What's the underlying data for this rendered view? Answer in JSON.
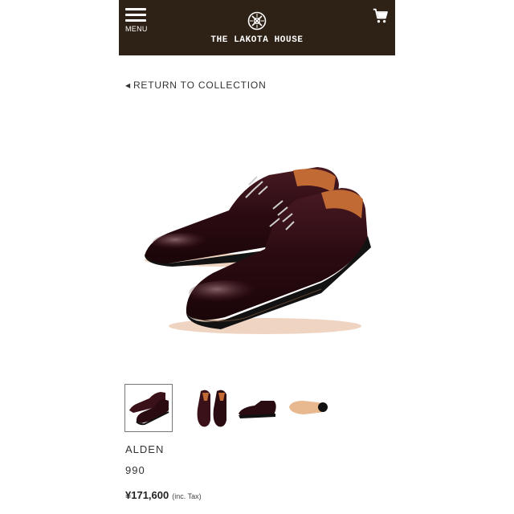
{
  "header": {
    "menu_label": "MENU",
    "brand": "THE LAKOTA HOUSE",
    "logo_icon": "lakota-emblem-icon",
    "cart_icon": "cart-icon",
    "background": "#2e2115"
  },
  "nav": {
    "back_label": "RETURN TO COLLECTION"
  },
  "product": {
    "main_image": "oxford-shoe-pair-image",
    "thumbnails": [
      {
        "name": "pair-angled-view",
        "selected": true
      },
      {
        "name": "pair-top-view",
        "selected": false
      },
      {
        "name": "side-view",
        "selected": false
      },
      {
        "name": "sole-view",
        "selected": false
      }
    ],
    "brand": "ALDEN",
    "model": "990",
    "price": "¥171,600",
    "tax_note": "(inc. Tax)"
  }
}
